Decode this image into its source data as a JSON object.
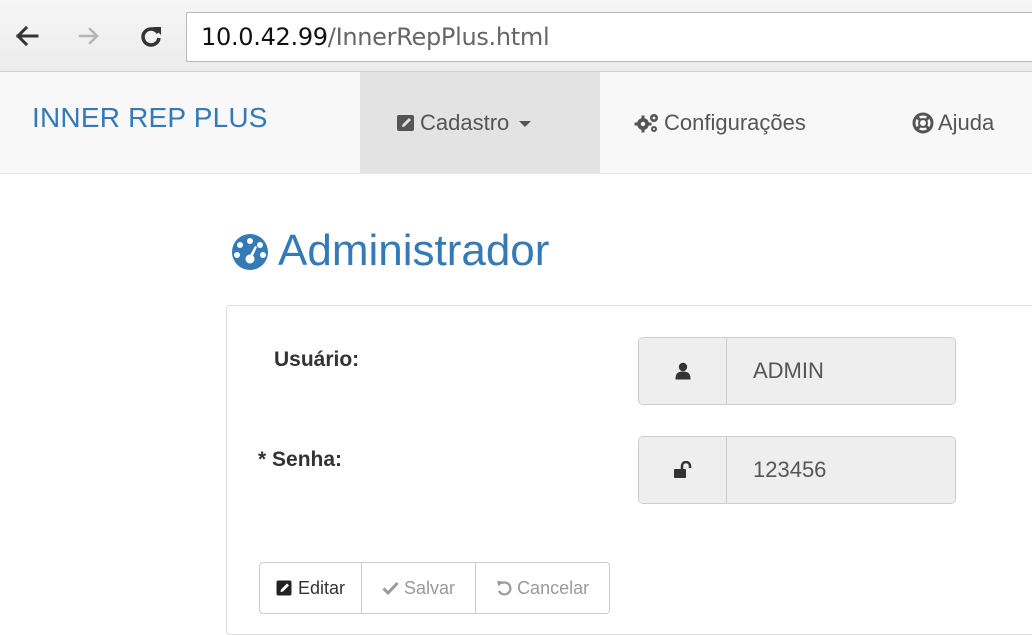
{
  "browser": {
    "url_host": "10.0.42.99",
    "url_path": "/InnerRepPlus.html",
    "back_icon": "arrow-left-icon",
    "forward_icon": "arrow-right-icon",
    "reload_icon": "reload-icon"
  },
  "navbar": {
    "brand": "INNER REP PLUS",
    "items": [
      {
        "label": "Cadastro",
        "icon": "edit-icon",
        "active": true,
        "dropdown": true
      },
      {
        "label": "Configurações",
        "icon": "cogs-icon",
        "active": false,
        "dropdown": false
      },
      {
        "label": "Ajuda",
        "icon": "life-ring-icon",
        "active": false,
        "dropdown": false
      }
    ]
  },
  "page": {
    "title": "Administrador",
    "title_icon": "dashboard-icon"
  },
  "form": {
    "user_label": "Usuário:",
    "user_value": "ADMIN",
    "password_label": "* Senha:",
    "password_value": "123456"
  },
  "actions": {
    "edit": "Editar",
    "save": "Salvar",
    "cancel": "Cancelar"
  },
  "colors": {
    "brand": "#337ab7",
    "navbar_bg": "#f8f8f8",
    "active_nav_bg": "#e3e3e3",
    "input_bg": "#eeeeee"
  }
}
